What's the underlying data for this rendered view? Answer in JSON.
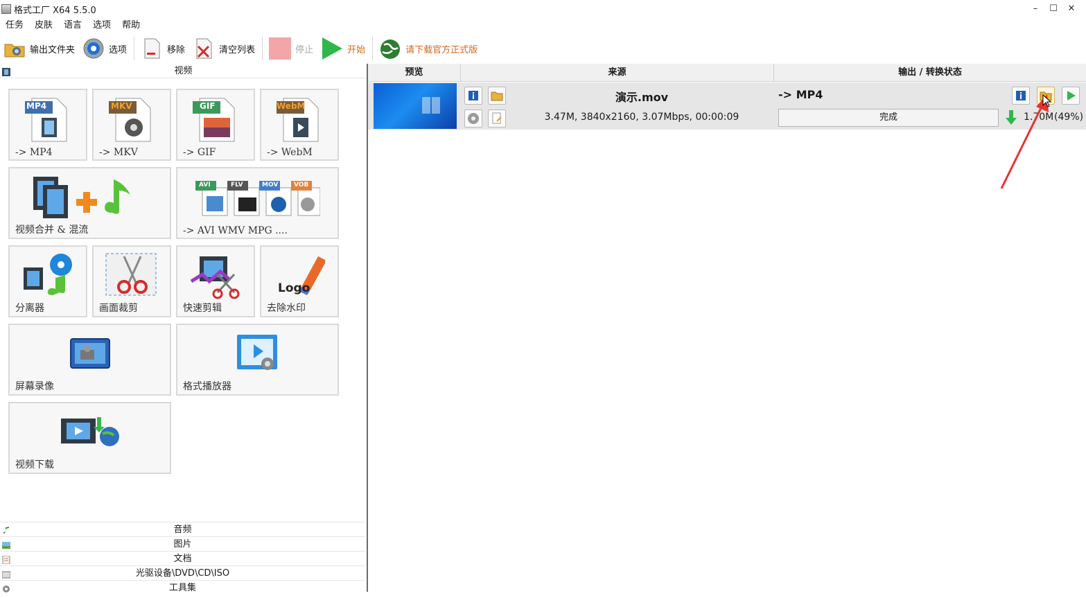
{
  "window": {
    "title": "格式工厂 X64 5.5.0",
    "minimize_label": "–",
    "maximize_label": "☐",
    "close_label": "✕"
  },
  "menu": [
    "任务",
    "皮肤",
    "语言",
    "选项",
    "帮助"
  ],
  "toolbar": {
    "output_folder": "输出文件夹",
    "options": "选项",
    "remove": "移除",
    "clear_list": "清空列表",
    "stop": "停止",
    "start": "开始",
    "download_official": "请下载官方正式版"
  },
  "left": {
    "video_section": "视频",
    "tiles": {
      "mp4": "-> MP4",
      "mp4_badge": "MP4",
      "mkv": "-> MKV",
      "mkv_badge": "MKV",
      "gif": "-> GIF",
      "gif_badge": "GIF",
      "webm": "-> WebM",
      "webm_badge": "WebM",
      "merge": "视频合并 & 混流",
      "avi": "-> AVI WMV MPG ....",
      "avi_badges": [
        "AVI",
        "FLV",
        "MOV",
        "VOB"
      ],
      "splitter": "分离器",
      "crop": "画面裁剪",
      "quick_edit": "快速剪辑",
      "remove_logo": "去除水印",
      "logo_text": "Logo",
      "screen_record": "屏幕录像",
      "player": "格式播放器",
      "download": "视频下载"
    },
    "sections": [
      "音频",
      "图片",
      "文档",
      "光驱设备\\DVD\\CD\\ISO",
      "工具集"
    ]
  },
  "right": {
    "headers": {
      "preview": "预览",
      "source": "来源",
      "output": "输出 / 转换状态"
    },
    "task": {
      "filename": "演示.mov",
      "info": "3.47M, 3840x2160, 3.07Mbps, 00:00:09",
      "output_format": "-> MP4",
      "status": "完成",
      "output_size": "1.70M",
      "ratio": "(49%)"
    }
  },
  "colors": {
    "accent_blue": "#1f8ce6",
    "start_green": "#2fb84a",
    "stop_pink": "#f2a6a8",
    "annotation_red": "#e8332e"
  }
}
